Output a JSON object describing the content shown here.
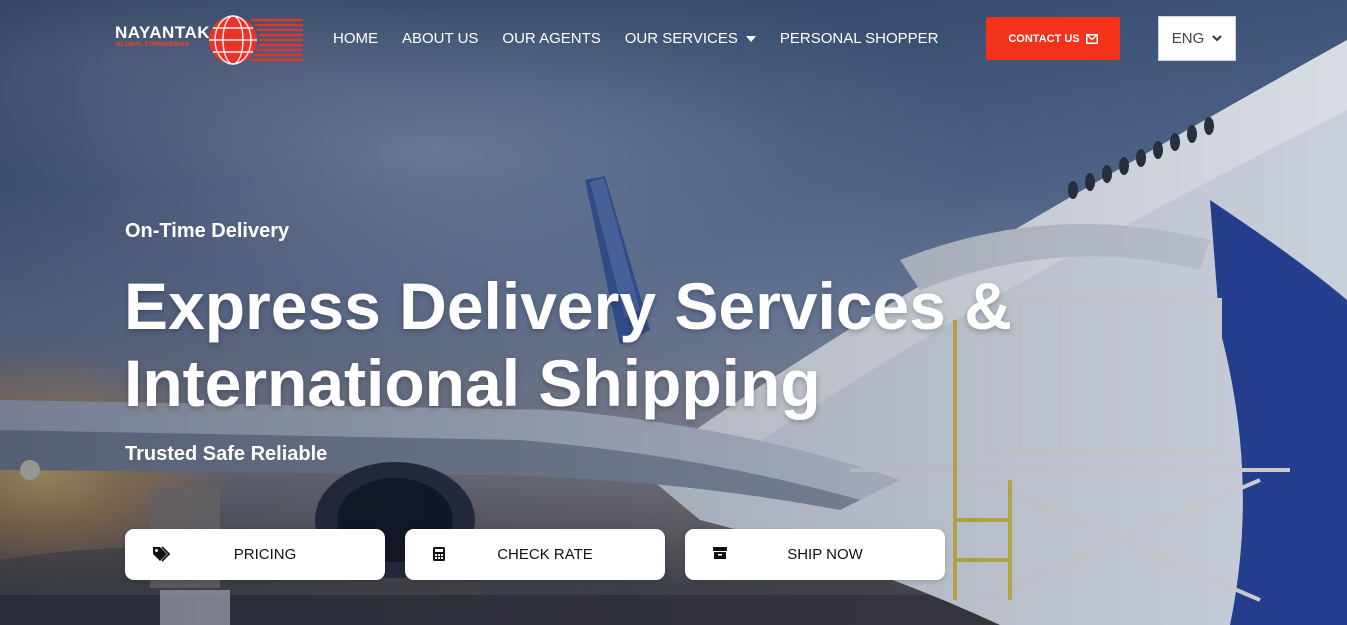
{
  "brand": {
    "name": "NAYANTAKA",
    "subtitle": "GLOBAL FORWARDING",
    "accent_color": "#f3321a"
  },
  "nav": {
    "items": [
      {
        "label": "HOME"
      },
      {
        "label": "ABOUT US"
      },
      {
        "label": "OUR AGENTS"
      },
      {
        "label": "OUR SERVICES",
        "has_dropdown": true
      },
      {
        "label": "PERSONAL SHOPPER"
      }
    ]
  },
  "header": {
    "contact_label": "CONTACT US",
    "contact_icon": "envelope-icon",
    "language": {
      "selected": "ENG"
    }
  },
  "hero": {
    "eyebrow": "On-Time Delivery",
    "headline_line1": "Express Delivery Services &",
    "headline_line2": "International Shipping",
    "tagline": "Trusted Safe Reliable"
  },
  "cta": [
    {
      "label": "PRICING",
      "icon": "tags-icon"
    },
    {
      "label": "CHECK RATE",
      "icon": "calculator-icon"
    },
    {
      "label": "SHIP NOW",
      "icon": "archive-box-icon"
    }
  ]
}
